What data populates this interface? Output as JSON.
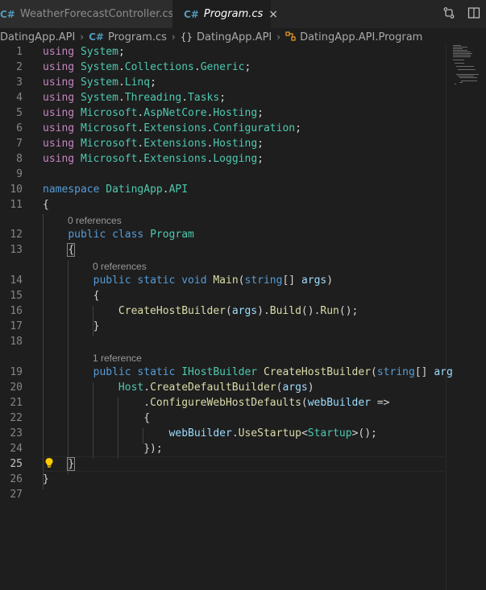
{
  "tabs": [
    {
      "icon": "C#",
      "label": "WeatherForecastController.cs",
      "active": false
    },
    {
      "icon": "C#",
      "label": "Program.cs",
      "active": true,
      "close": "×"
    }
  ],
  "breadcrumb": {
    "project": "DatingApp.API",
    "file": "Program.cs",
    "namespace_icon": "{}",
    "namespace": "DatingApp.API",
    "class": "DatingApp.API.Program"
  },
  "code_lens": {
    "program": "0 references",
    "main": "0 references",
    "create_host": "1 reference"
  },
  "lines": [
    {
      "n": "1",
      "tokens": [
        [
          "ctl",
          "using "
        ],
        [
          "ns",
          "System"
        ],
        [
          "pl",
          ";"
        ]
      ]
    },
    {
      "n": "2",
      "tokens": [
        [
          "ctl",
          "using "
        ],
        [
          "ns",
          "System"
        ],
        [
          "pl",
          "."
        ],
        [
          "ns",
          "Collections"
        ],
        [
          "pl",
          "."
        ],
        [
          "ns",
          "Generic"
        ],
        [
          "pl",
          ";"
        ]
      ]
    },
    {
      "n": "3",
      "tokens": [
        [
          "ctl",
          "using "
        ],
        [
          "ns",
          "System"
        ],
        [
          "pl",
          "."
        ],
        [
          "ns",
          "Linq"
        ],
        [
          "pl",
          ";"
        ]
      ]
    },
    {
      "n": "4",
      "tokens": [
        [
          "ctl",
          "using "
        ],
        [
          "ns",
          "System"
        ],
        [
          "pl",
          "."
        ],
        [
          "ns",
          "Threading"
        ],
        [
          "pl",
          "."
        ],
        [
          "ns",
          "Tasks"
        ],
        [
          "pl",
          ";"
        ]
      ]
    },
    {
      "n": "5",
      "tokens": [
        [
          "ctl",
          "using "
        ],
        [
          "ns",
          "Microsoft"
        ],
        [
          "pl",
          "."
        ],
        [
          "ns",
          "AspNetCore"
        ],
        [
          "pl",
          "."
        ],
        [
          "ns",
          "Hosting"
        ],
        [
          "pl",
          ";"
        ]
      ]
    },
    {
      "n": "6",
      "tokens": [
        [
          "ctl",
          "using "
        ],
        [
          "ns",
          "Microsoft"
        ],
        [
          "pl",
          "."
        ],
        [
          "ns",
          "Extensions"
        ],
        [
          "pl",
          "."
        ],
        [
          "ns",
          "Configuration"
        ],
        [
          "pl",
          ";"
        ]
      ]
    },
    {
      "n": "7",
      "tokens": [
        [
          "ctl",
          "using "
        ],
        [
          "ns",
          "Microsoft"
        ],
        [
          "pl",
          "."
        ],
        [
          "ns",
          "Extensions"
        ],
        [
          "pl",
          "."
        ],
        [
          "ns",
          "Hosting"
        ],
        [
          "pl",
          ";"
        ]
      ]
    },
    {
      "n": "8",
      "tokens": [
        [
          "ctl",
          "using "
        ],
        [
          "ns",
          "Microsoft"
        ],
        [
          "pl",
          "."
        ],
        [
          "ns",
          "Extensions"
        ],
        [
          "pl",
          "."
        ],
        [
          "ns",
          "Logging"
        ],
        [
          "pl",
          ";"
        ]
      ]
    },
    {
      "n": "9",
      "tokens": []
    },
    {
      "n": "10",
      "tokens": [
        [
          "kw",
          "namespace "
        ],
        [
          "ns",
          "DatingApp"
        ],
        [
          "pl",
          "."
        ],
        [
          "ns",
          "API"
        ]
      ]
    },
    {
      "n": "11",
      "tokens": [
        [
          "pl",
          "{"
        ]
      ]
    },
    {
      "n": "12",
      "tokens": [
        [
          "pl",
          "    "
        ],
        [
          "kw",
          "public "
        ],
        [
          "kw",
          "class "
        ],
        [
          "ty",
          "Program"
        ]
      ]
    },
    {
      "n": "13",
      "tokens": [
        [
          "pl",
          "    "
        ],
        [
          "pl",
          "{"
        ]
      ]
    },
    {
      "n": "14",
      "tokens": [
        [
          "pl",
          "        "
        ],
        [
          "kw",
          "public "
        ],
        [
          "kw",
          "static "
        ],
        [
          "kw",
          "void "
        ],
        [
          "fn",
          "Main"
        ],
        [
          "pl",
          "("
        ],
        [
          "kw",
          "string"
        ],
        [
          "pl",
          "[] "
        ],
        [
          "par",
          "args"
        ],
        [
          "pl",
          ")"
        ]
      ]
    },
    {
      "n": "15",
      "tokens": [
        [
          "pl",
          "        {"
        ]
      ]
    },
    {
      "n": "16",
      "tokens": [
        [
          "pl",
          "            "
        ],
        [
          "fn",
          "CreateHostBuilder"
        ],
        [
          "pl",
          "("
        ],
        [
          "par",
          "args"
        ],
        [
          "pl",
          ")."
        ],
        [
          "fn",
          "Build"
        ],
        [
          "pl",
          "()."
        ],
        [
          "fn",
          "Run"
        ],
        [
          "pl",
          "();"
        ]
      ]
    },
    {
      "n": "17",
      "tokens": [
        [
          "pl",
          "        }"
        ]
      ]
    },
    {
      "n": "18",
      "tokens": []
    },
    {
      "n": "19",
      "tokens": [
        [
          "pl",
          "        "
        ],
        [
          "kw",
          "public "
        ],
        [
          "kw",
          "static "
        ],
        [
          "ty",
          "IHostBuilder "
        ],
        [
          "fn",
          "CreateHostBuilder"
        ],
        [
          "pl",
          "("
        ],
        [
          "kw",
          "string"
        ],
        [
          "pl",
          "[] "
        ],
        [
          "par",
          "arg"
        ]
      ]
    },
    {
      "n": "20",
      "tokens": [
        [
          "pl",
          "            "
        ],
        [
          "ty",
          "Host"
        ],
        [
          "pl",
          "."
        ],
        [
          "fn",
          "CreateDefaultBuilder"
        ],
        [
          "pl",
          "("
        ],
        [
          "par",
          "args"
        ],
        [
          "pl",
          ")"
        ]
      ]
    },
    {
      "n": "21",
      "tokens": [
        [
          "pl",
          "                ."
        ],
        [
          "fn",
          "ConfigureWebHostDefaults"
        ],
        [
          "pl",
          "("
        ],
        [
          "par",
          "webBuilder"
        ],
        [
          "pl",
          " =>"
        ]
      ]
    },
    {
      "n": "22",
      "tokens": [
        [
          "pl",
          "                {"
        ]
      ]
    },
    {
      "n": "23",
      "tokens": [
        [
          "pl",
          "                    "
        ],
        [
          "par",
          "webBuilder"
        ],
        [
          "pl",
          "."
        ],
        [
          "fn",
          "UseStartup"
        ],
        [
          "pl",
          "<"
        ],
        [
          "ty",
          "Startup"
        ],
        [
          "pl",
          ">();"
        ]
      ]
    },
    {
      "n": "24",
      "tokens": [
        [
          "pl",
          "                });"
        ]
      ]
    },
    {
      "n": "25",
      "tokens": [
        [
          "pl",
          "    "
        ],
        [
          "pl",
          "}"
        ]
      ]
    },
    {
      "n": "26",
      "tokens": [
        [
          "pl",
          "}"
        ]
      ]
    },
    {
      "n": "27",
      "tokens": []
    }
  ]
}
